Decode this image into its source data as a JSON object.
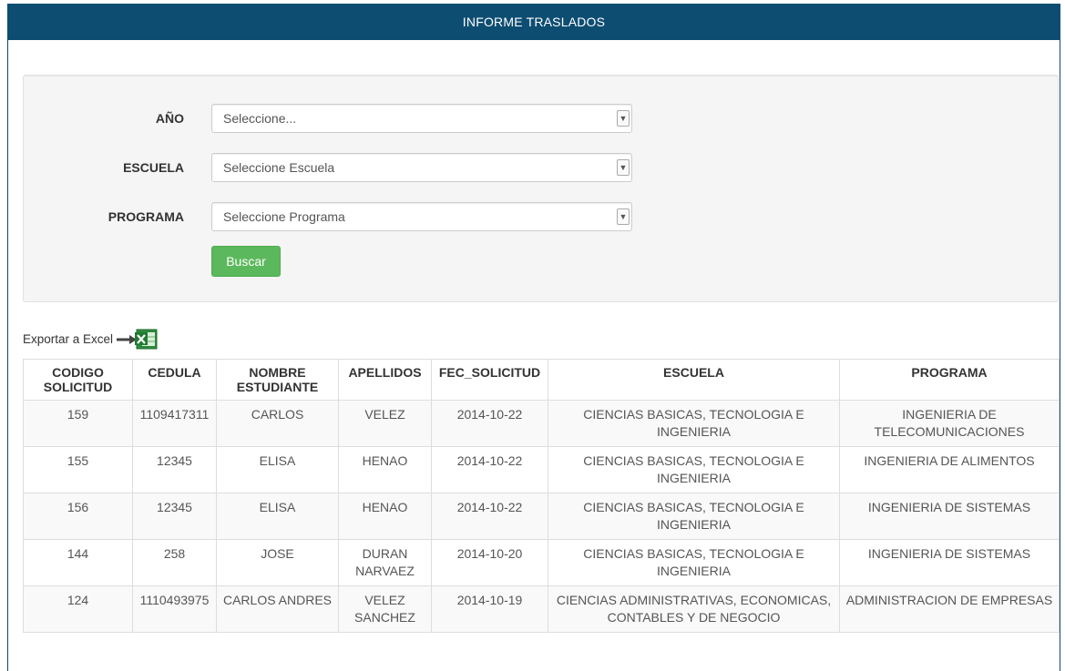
{
  "header": {
    "title": "INFORME TRASLADOS"
  },
  "filters": {
    "year": {
      "label": "AÑO",
      "value": "Seleccione..."
    },
    "school": {
      "label": "ESCUELA",
      "value": "Seleccione Escuela"
    },
    "program": {
      "label": "PROGRAMA",
      "value": "Seleccione Programa"
    },
    "search_button": "Buscar"
  },
  "export": {
    "label": "Exportar a Excel",
    "icon": "excel-export-icon"
  },
  "table": {
    "columns": [
      "CODIGO SOLICITUD",
      "CEDULA",
      "NOMBRE ESTUDIANTE",
      "APELLIDOS",
      "FEC_SOLICITUD",
      "ESCUELA",
      "PROGRAMA"
    ],
    "rows": [
      [
        "159",
        "1109417311",
        "CARLOS",
        "VELEZ",
        "2014-10-22",
        "CIENCIAS BASICAS, TECNOLOGIA E INGENIERIA",
        "INGENIERIA DE TELECOMUNICACIONES"
      ],
      [
        "155",
        "12345",
        "ELISA",
        "HENAO",
        "2014-10-22",
        "CIENCIAS BASICAS, TECNOLOGIA E INGENIERIA",
        "INGENIERIA DE ALIMENTOS"
      ],
      [
        "156",
        "12345",
        "ELISA",
        "HENAO",
        "2014-10-22",
        "CIENCIAS BASICAS, TECNOLOGIA E INGENIERIA",
        "INGENIERIA DE SISTEMAS"
      ],
      [
        "144",
        "258",
        "JOSE",
        "DURAN NARVAEZ",
        "2014-10-20",
        "CIENCIAS BASICAS, TECNOLOGIA E INGENIERIA",
        "INGENIERIA DE SISTEMAS"
      ],
      [
        "124",
        "1110493975",
        "CARLOS ANDRES",
        "VELEZ SANCHEZ",
        "2014-10-19",
        "CIENCIAS ADMINISTRATIVAS, ECONOMICAS, CONTABLES Y DE NEGOCIO",
        "ADMINISTRACION DE EMPRESAS"
      ]
    ]
  },
  "colors": {
    "header_bg": "#0d4d72",
    "button_bg": "#5cb85c",
    "panel_bg": "#f5f5f5"
  }
}
